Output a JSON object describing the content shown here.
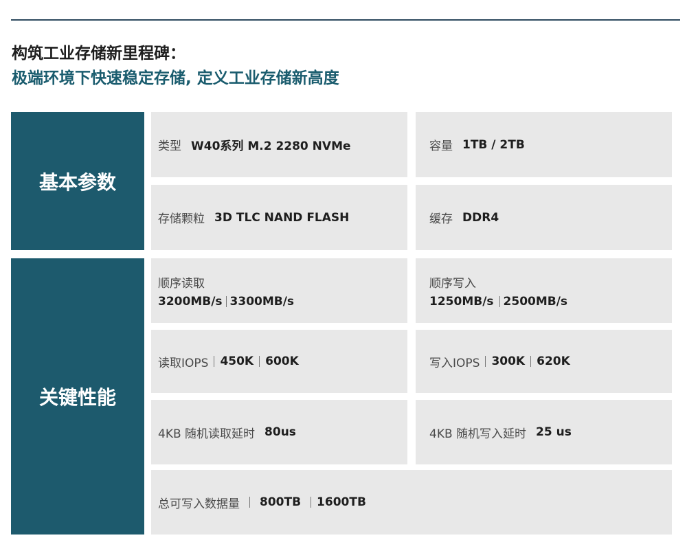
{
  "header": {
    "title": "构筑工业存储新里程碑：",
    "subtitle": "极端环境下快速稳定存储, 定义工业存储新高度"
  },
  "basic_params": {
    "label": "基本参数",
    "type_label": "类型",
    "type_value": "W40系列 M.2 2280 NVMe",
    "capacity_label": "容量",
    "capacity_value": "1TB / 2TB",
    "flash_label": "存储颗粒",
    "flash_value": "3D TLC NAND FLASH",
    "cache_label": "缓存",
    "cache_value": "DDR4"
  },
  "performance": {
    "label": "关键性能",
    "seq_read_label": "顺序读取",
    "seq_read_value_1": "3200MB/s",
    "seq_read_value_2": "3300MB/s",
    "seq_write_label": "顺序写入",
    "seq_write_value_1": "1250MB/s",
    "seq_write_value_2": "2500MB/s",
    "read_iops_label": "读取IOPS",
    "read_iops_value_1": "450K",
    "read_iops_value_2": "600K",
    "write_iops_label": "写入IOPS",
    "write_iops_value_1": "300K",
    "write_iops_value_2": "620K",
    "read_latency_label": "4KB 随机读取延时",
    "read_latency_value": "80us",
    "write_latency_label": "4KB 随机写入延时",
    "write_latency_value": "25 us",
    "tbw_label": "总可写入数据量",
    "tbw_value_1": "800TB",
    "tbw_value_2": "1600TB"
  }
}
